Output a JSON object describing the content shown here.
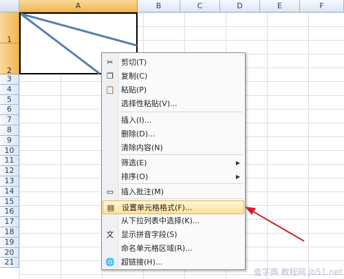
{
  "columns": [
    "A",
    "B",
    "C",
    "D",
    "E",
    "F"
  ],
  "rows": [
    "1",
    "2",
    "3",
    "4",
    "5",
    "6",
    "7",
    "8",
    "9",
    "10",
    "11",
    "12",
    "13",
    "14",
    "15",
    "16",
    "17",
    "18",
    "19",
    "20",
    "21"
  ],
  "context_menu": {
    "items": [
      {
        "label": "剪切(T)",
        "icon": "cut-icon",
        "glyph": "✂"
      },
      {
        "label": "复制(C)",
        "icon": "copy-icon",
        "glyph": "❐"
      },
      {
        "label": "粘贴(P)",
        "icon": "paste-icon",
        "glyph": "📋"
      },
      {
        "label": "选择性粘贴(V)...",
        "icon": "",
        "glyph": ""
      },
      {
        "label": "插入(I)...",
        "icon": "",
        "glyph": ""
      },
      {
        "label": "删除(D)...",
        "icon": "",
        "glyph": ""
      },
      {
        "label": "清除内容(N)",
        "icon": "",
        "glyph": ""
      },
      {
        "label": "筛选(E)",
        "icon": "",
        "glyph": "",
        "submenu": true
      },
      {
        "label": "排序(O)",
        "icon": "",
        "glyph": "",
        "submenu": true
      },
      {
        "label": "插入批注(M)",
        "icon": "comment-icon",
        "glyph": "▭"
      },
      {
        "label": "设置单元格格式(F)...",
        "icon": "format-cells-icon",
        "glyph": "▤",
        "highlighted": true
      },
      {
        "label": "从下拉列表中选择(K)...",
        "icon": "",
        "glyph": ""
      },
      {
        "label": "显示拼音字段(S)",
        "icon": "phonetic-icon",
        "glyph": "文"
      },
      {
        "label": "命名单元格区域(R)...",
        "icon": "",
        "glyph": ""
      },
      {
        "label": "超链接(H)...",
        "icon": "hyperlink-icon",
        "glyph": "🌐"
      }
    ]
  },
  "watermark": "查字典 教程网 jb51.net",
  "colors": {
    "arrow": "#d0202a",
    "diagonal": "#5a7fab",
    "highlight": "#ffe193"
  }
}
